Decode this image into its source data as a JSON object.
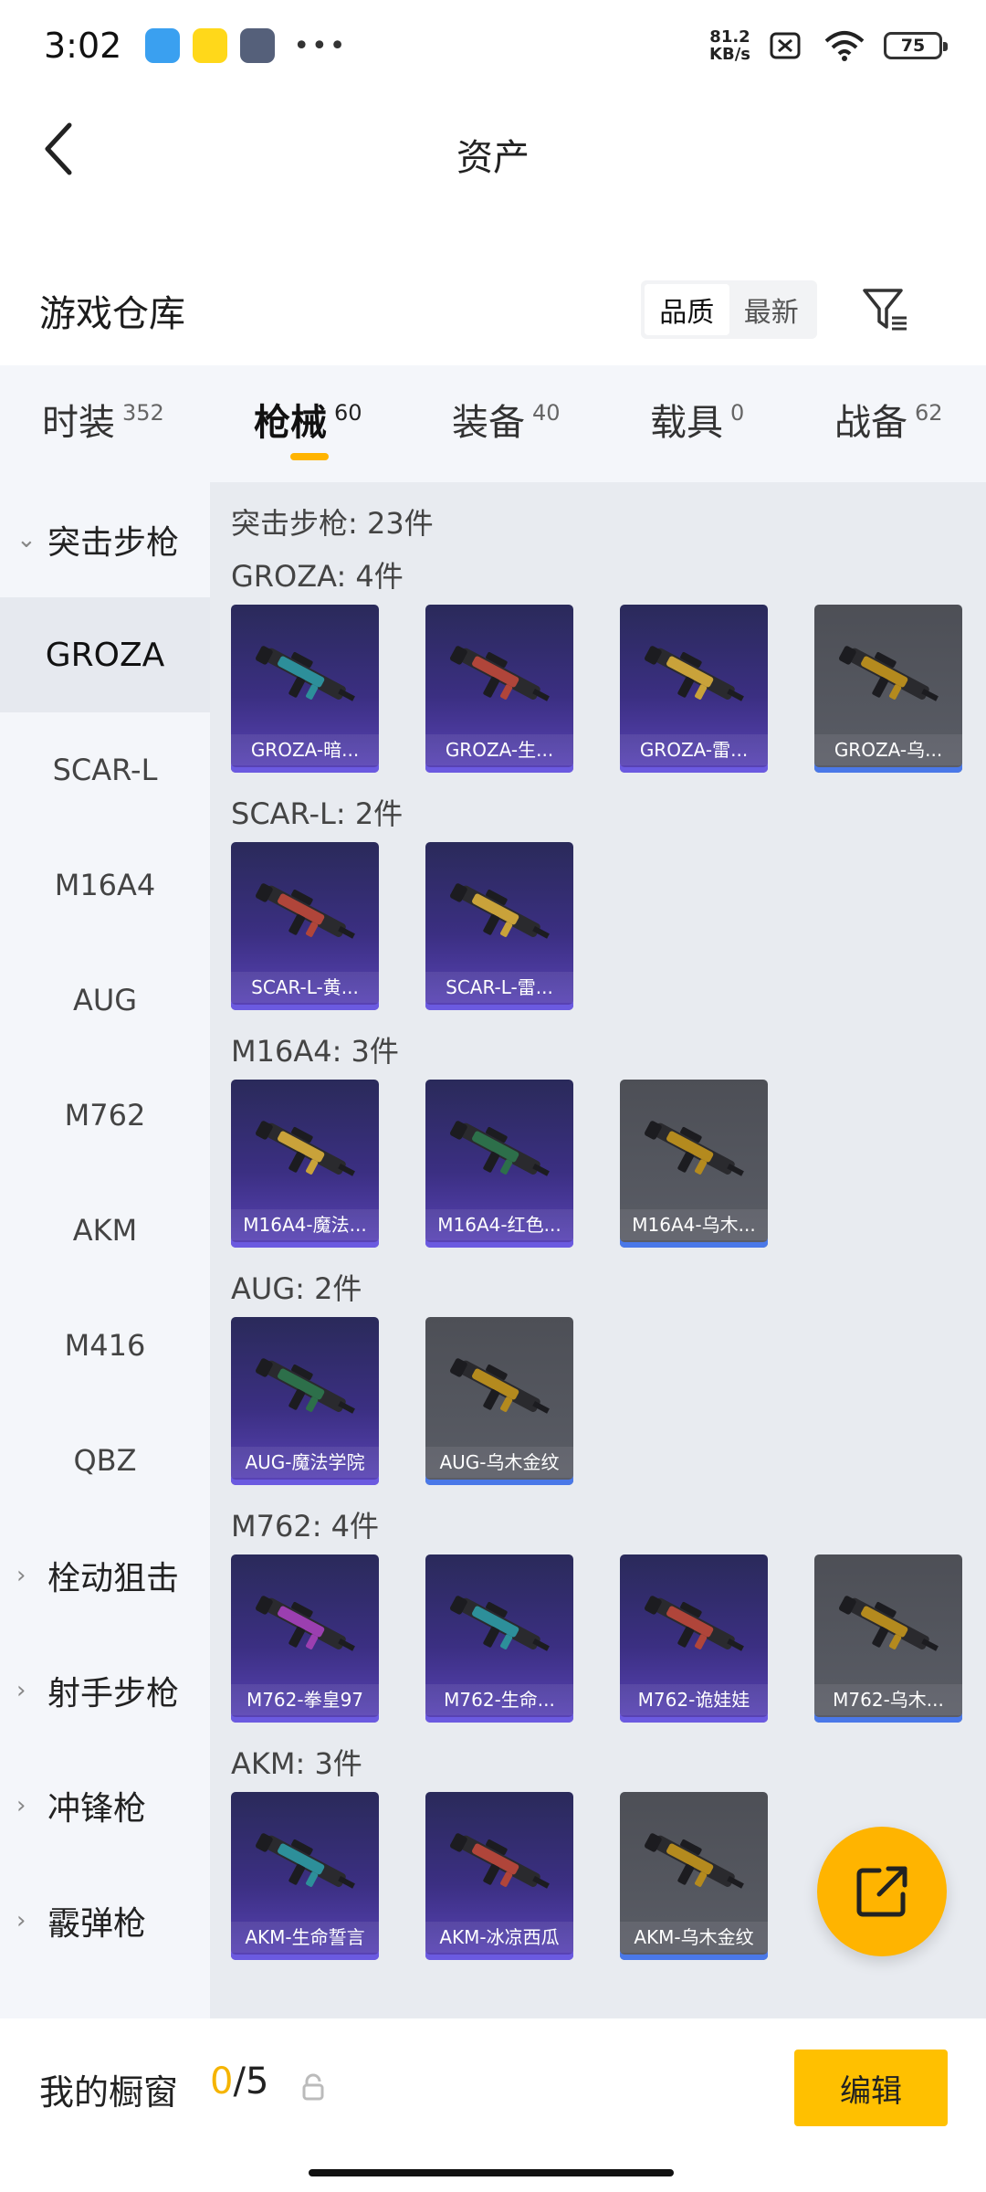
{
  "status_bar": {
    "time": "3:02",
    "speed_value": "81.2",
    "speed_unit": "KB/s",
    "battery": "75",
    "icons": [
      "app-icon-blue",
      "app-icon-yellow",
      "app-icon-game",
      "more-dots",
      "no-sim-icon",
      "wifi-icon",
      "battery-icon"
    ]
  },
  "header": {
    "title": "资产"
  },
  "warehouse": {
    "title": "游戏仓库",
    "sort_options": [
      "品质",
      "最新"
    ],
    "sort_active": "品质"
  },
  "tabs": [
    {
      "label": "时装",
      "count": "352"
    },
    {
      "label": "枪械",
      "count": "60",
      "active": true
    },
    {
      "label": "装备",
      "count": "40"
    },
    {
      "label": "载具",
      "count": "0"
    },
    {
      "label": "战备",
      "count": "62"
    }
  ],
  "sidebar": {
    "groups": [
      {
        "label": "突击步枪",
        "expanded": true
      },
      {
        "label": "栓动狙击"
      },
      {
        "label": "射手步枪"
      },
      {
        "label": "冲锋枪"
      },
      {
        "label": "霰弹枪"
      }
    ],
    "items": [
      "GROZA",
      "SCAR-L",
      "M16A4",
      "AUG",
      "M762",
      "AKM",
      "M416",
      "QBZ"
    ],
    "active_item": "GROZA"
  },
  "content": {
    "summary": "突击步枪: 23件",
    "sections": [
      {
        "title": "GROZA: 4件",
        "cards": [
          {
            "name": "GROZA-暗...",
            "tier": "purple"
          },
          {
            "name": "GROZA-生...",
            "tier": "purple"
          },
          {
            "name": "GROZA-雷...",
            "tier": "purple"
          },
          {
            "name": "GROZA-乌...",
            "tier": "gray"
          }
        ]
      },
      {
        "title": "SCAR-L: 2件",
        "cards": [
          {
            "name": "SCAR-L-黄...",
            "tier": "purple"
          },
          {
            "name": "SCAR-L-雷...",
            "tier": "purple"
          }
        ]
      },
      {
        "title": "M16A4: 3件",
        "cards": [
          {
            "name": "M16A4-魔法...",
            "tier": "purple"
          },
          {
            "name": "M16A4-红色...",
            "tier": "purple"
          },
          {
            "name": "M16A4-乌木...",
            "tier": "gray"
          }
        ]
      },
      {
        "title": "AUG: 2件",
        "cards": [
          {
            "name": "AUG-魔法学院",
            "tier": "purple"
          },
          {
            "name": "AUG-乌木金纹",
            "tier": "gray"
          }
        ]
      },
      {
        "title": "M762: 4件",
        "cards": [
          {
            "name": "M762-拳皇97",
            "tier": "purple"
          },
          {
            "name": "M762-生命...",
            "tier": "purple"
          },
          {
            "name": "M762-诡娃娃",
            "tier": "purple"
          },
          {
            "name": "M762-乌木...",
            "tier": "gray"
          }
        ]
      },
      {
        "title": "AKM: 3件",
        "cards": [
          {
            "name": "AKM-生命誓言",
            "tier": "purple"
          },
          {
            "name": "AKM-冰凉西瓜",
            "tier": "purple"
          },
          {
            "name": "AKM-乌木金纹",
            "tier": "gray"
          }
        ]
      }
    ]
  },
  "showcase": {
    "label": "我的橱窗",
    "current": "0",
    "separator": "/",
    "max": "5",
    "edit_label": "编辑"
  },
  "colors": {
    "accent": "#ffb400",
    "card_purple": "#3b2f82",
    "card_gray": "#55575e"
  }
}
